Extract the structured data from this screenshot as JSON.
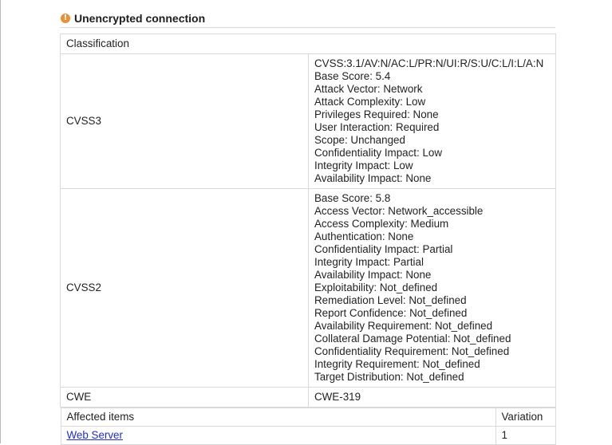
{
  "section": {
    "title": "Unencrypted connection",
    "severity_icon": "warning-icon",
    "severity_color": "#e8903a"
  },
  "classification": {
    "heading": "Classification",
    "rows": [
      {
        "label": "CVSS3",
        "values": [
          "CVSS:3.1/AV:N/AC:L/PR:N/UI:R/S:U/C:L/I:L/A:N",
          "Base Score: 5.4",
          "Attack Vector: Network",
          "Attack Complexity: Low",
          "Privileges Required: None",
          "User Interaction: Required",
          "Scope: Unchanged",
          "Confidentiality Impact: Low",
          "Integrity Impact: Low",
          "Availability Impact: None"
        ]
      },
      {
        "label": "CVSS2",
        "values": [
          "Base Score: 5.8",
          "Access Vector: Network_accessible",
          "Access Complexity: Medium",
          "Authentication: None",
          "Confidentiality Impact: Partial",
          "Integrity Impact: Partial",
          "Availability Impact: None",
          "Exploitability: Not_defined",
          "Remediation Level: Not_defined",
          "Report Confidence: Not_defined",
          "Availability Requirement: Not_defined",
          "Collateral Damage Potential: Not_defined",
          "Confidentiality Requirement: Not_defined",
          "Integrity Requirement: Not_defined",
          "Target Distribution: Not_defined"
        ]
      },
      {
        "label": "CWE",
        "values": [
          "CWE-319"
        ]
      }
    ]
  },
  "affected": {
    "header_items": "Affected items",
    "header_variation": "Variation",
    "rows": [
      {
        "item": "Web Server",
        "variation": "1"
      }
    ]
  }
}
